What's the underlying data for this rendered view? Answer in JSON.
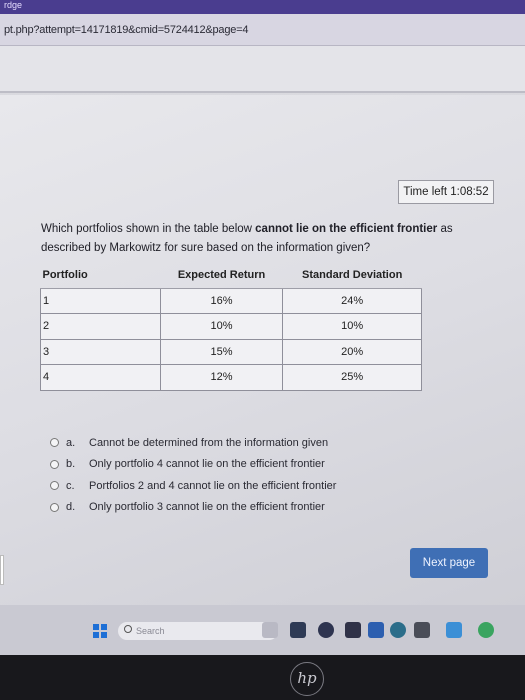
{
  "browser": {
    "tab_fragment": "rdge",
    "url": "pt.php?attempt=14171819&cmid=5724412&page=4"
  },
  "quiz": {
    "timer": "Time left 1:08:52",
    "question_pre": "Which portfolios shown in the table below ",
    "question_bold": "cannot lie on the efficient frontier",
    "question_post": " as described by Markowitz for sure based on the information given?",
    "table": {
      "headers": [
        "Portfolio",
        "Expected Return",
        "Standard Deviation"
      ],
      "rows": [
        [
          "1",
          "16%",
          "24%"
        ],
        [
          "2",
          "10%",
          "10%"
        ],
        [
          "3",
          "15%",
          "20%"
        ],
        [
          "4",
          "12%",
          "25%"
        ]
      ]
    },
    "options": [
      {
        "letter": "a.",
        "text": "Cannot be determined from the information given"
      },
      {
        "letter": "b.",
        "text": "Only portfolio 4 cannot lie on the efficient frontier"
      },
      {
        "letter": "c.",
        "text": "Portfolios 2 and 4 cannot lie on the efficient frontier"
      },
      {
        "letter": "d.",
        "text": "Only portfolio 3 cannot lie on the efficient frontier"
      }
    ],
    "next_label": "Next page"
  },
  "taskbar": {
    "search_placeholder": "Search",
    "icons": [
      "windows-icon",
      "search-icon",
      "widgets-icon",
      "file-explorer-icon",
      "chat-icon",
      "store-icon",
      "mail-icon",
      "edge-icon",
      "office-icon",
      "photos-icon",
      "chrome-icon"
    ],
    "accent": "#1d6fd6"
  },
  "device": {
    "brand": "hp"
  }
}
